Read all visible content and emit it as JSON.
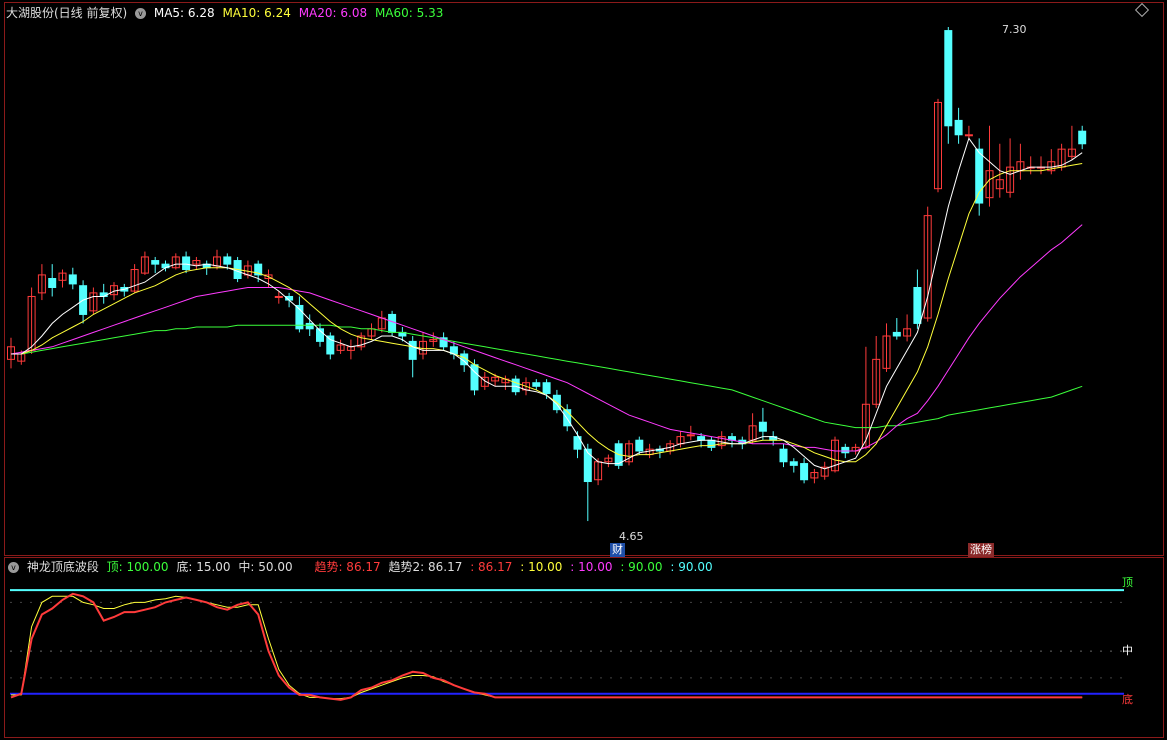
{
  "header": {
    "stock_title": "大湖股份(日线 前复权)",
    "ma5": "MA5: 6.28",
    "ma10": "MA10: 6.24",
    "ma20": "MA20: 6.08",
    "ma60": "MA60: 5.33"
  },
  "indicator": {
    "name": "神龙顶底波段",
    "top": "顶: 100.00",
    "bottom": "底: 15.00",
    "mid": "中: 50.00",
    "trend": "趋势: 86.17",
    "trend2": "趋势2: 86.17",
    "v1": ": 86.17",
    "v2": ": 10.00",
    "v3": ": 10.00",
    "v4": ": 90.00",
    "v5": ": 90.00",
    "label_top": "顶",
    "label_mid": "中",
    "label_bottom": "底"
  },
  "annotations": {
    "high_price": "7.30",
    "low_price": "4.65",
    "cai_badge": "财",
    "zhangting_badge": "涨榜"
  },
  "colors": {
    "up": "#ff3b3b",
    "down": "#54ffff",
    "ma5": "#ffffff",
    "ma10": "#ffff3b",
    "ma20": "#ff3bff",
    "ma60": "#3bff3b",
    "frame": "#8b1a1a"
  },
  "chart_data": {
    "type": "candlestick",
    "y_range": [
      4.5,
      7.45
    ],
    "candles": [
      {
        "o": 5.55,
        "c": 5.62,
        "h": 5.67,
        "l": 5.5
      },
      {
        "o": 5.54,
        "c": 5.58,
        "h": 5.6,
        "l": 5.52
      },
      {
        "o": 5.6,
        "c": 5.9,
        "h": 5.95,
        "l": 5.58
      },
      {
        "o": 5.92,
        "c": 6.02,
        "h": 6.08,
        "l": 5.88
      },
      {
        "o": 6.0,
        "c": 5.95,
        "h": 6.08,
        "l": 5.9
      },
      {
        "o": 5.99,
        "c": 6.03,
        "h": 6.05,
        "l": 5.95
      },
      {
        "o": 6.02,
        "c": 5.97,
        "h": 6.06,
        "l": 5.94
      },
      {
        "o": 5.96,
        "c": 5.8,
        "h": 5.99,
        "l": 5.75
      },
      {
        "o": 5.82,
        "c": 5.92,
        "h": 5.95,
        "l": 5.8
      },
      {
        "o": 5.92,
        "c": 5.9,
        "h": 5.97,
        "l": 5.86
      },
      {
        "o": 5.91,
        "c": 5.96,
        "h": 5.98,
        "l": 5.88
      },
      {
        "o": 5.95,
        "c": 5.93,
        "h": 5.97,
        "l": 5.9
      },
      {
        "o": 5.93,
        "c": 6.05,
        "h": 6.08,
        "l": 5.92
      },
      {
        "o": 6.03,
        "c": 6.12,
        "h": 6.15,
        "l": 6.02
      },
      {
        "o": 6.1,
        "c": 6.08,
        "h": 6.12,
        "l": 6.03
      },
      {
        "o": 6.08,
        "c": 6.06,
        "h": 6.1,
        "l": 6.04
      },
      {
        "o": 6.06,
        "c": 6.12,
        "h": 6.14,
        "l": 6.05
      },
      {
        "o": 6.12,
        "c": 6.05,
        "h": 6.15,
        "l": 6.03
      },
      {
        "o": 6.08,
        "c": 6.1,
        "h": 6.12,
        "l": 6.05
      },
      {
        "o": 6.08,
        "c": 6.06,
        "h": 6.1,
        "l": 6.02
      },
      {
        "o": 6.07,
        "c": 6.12,
        "h": 6.16,
        "l": 6.05
      },
      {
        "o": 6.12,
        "c": 6.08,
        "h": 6.14,
        "l": 6.05
      },
      {
        "o": 6.1,
        "c": 6.0,
        "h": 6.12,
        "l": 5.98
      },
      {
        "o": 6.02,
        "c": 6.07,
        "h": 6.1,
        "l": 6.0
      },
      {
        "o": 6.08,
        "c": 6.02,
        "h": 6.1,
        "l": 5.98
      },
      {
        "o": 6.0,
        "c": 6.02,
        "h": 6.05,
        "l": 5.95
      },
      {
        "o": 5.9,
        "c": 5.9,
        "h": 5.93,
        "l": 5.86
      },
      {
        "o": 5.9,
        "c": 5.88,
        "h": 5.92,
        "l": 5.84
      },
      {
        "o": 5.85,
        "c": 5.72,
        "h": 5.9,
        "l": 5.7
      },
      {
        "o": 5.75,
        "c": 5.72,
        "h": 5.8,
        "l": 5.68
      },
      {
        "o": 5.72,
        "c": 5.65,
        "h": 5.75,
        "l": 5.62
      },
      {
        "o": 5.68,
        "c": 5.58,
        "h": 5.7,
        "l": 5.55
      },
      {
        "o": 5.6,
        "c": 5.63,
        "h": 5.66,
        "l": 5.58
      },
      {
        "o": 5.6,
        "c": 5.62,
        "h": 5.66,
        "l": 5.55
      },
      {
        "o": 5.62,
        "c": 5.68,
        "h": 5.7,
        "l": 5.6
      },
      {
        "o": 5.68,
        "c": 5.72,
        "h": 5.75,
        "l": 5.66
      },
      {
        "o": 5.72,
        "c": 5.78,
        "h": 5.82,
        "l": 5.7
      },
      {
        "o": 5.8,
        "c": 5.7,
        "h": 5.82,
        "l": 5.68
      },
      {
        "o": 5.7,
        "c": 5.68,
        "h": 5.73,
        "l": 5.65
      },
      {
        "o": 5.65,
        "c": 5.55,
        "h": 5.68,
        "l": 5.45
      },
      {
        "o": 5.58,
        "c": 5.65,
        "h": 5.7,
        "l": 5.55
      },
      {
        "o": 5.65,
        "c": 5.66,
        "h": 5.7,
        "l": 5.62
      },
      {
        "o": 5.67,
        "c": 5.62,
        "h": 5.7,
        "l": 5.6
      },
      {
        "o": 5.62,
        "c": 5.58,
        "h": 5.65,
        "l": 5.55
      },
      {
        "o": 5.58,
        "c": 5.52,
        "h": 5.6,
        "l": 5.48
      },
      {
        "o": 5.52,
        "c": 5.38,
        "h": 5.55,
        "l": 5.35
      },
      {
        "o": 5.4,
        "c": 5.45,
        "h": 5.48,
        "l": 5.38
      },
      {
        "o": 5.43,
        "c": 5.45,
        "h": 5.47,
        "l": 5.4
      },
      {
        "o": 5.42,
        "c": 5.44,
        "h": 5.46,
        "l": 5.38
      },
      {
        "o": 5.44,
        "c": 5.37,
        "h": 5.46,
        "l": 5.35
      },
      {
        "o": 5.38,
        "c": 5.42,
        "h": 5.45,
        "l": 5.35
      },
      {
        "o": 5.42,
        "c": 5.4,
        "h": 5.44,
        "l": 5.38
      },
      {
        "o": 5.42,
        "c": 5.36,
        "h": 5.44,
        "l": 5.33
      },
      {
        "o": 5.35,
        "c": 5.27,
        "h": 5.38,
        "l": 5.25
      },
      {
        "o": 5.27,
        "c": 5.18,
        "h": 5.3,
        "l": 5.15
      },
      {
        "o": 5.12,
        "c": 5.05,
        "h": 5.15,
        "l": 5.0
      },
      {
        "o": 5.05,
        "c": 4.87,
        "h": 5.08,
        "l": 4.65
      },
      {
        "o": 4.88,
        "c": 4.98,
        "h": 5.0,
        "l": 4.85
      },
      {
        "o": 4.98,
        "c": 5.0,
        "h": 5.02,
        "l": 4.95
      },
      {
        "o": 5.08,
        "c": 4.96,
        "h": 5.1,
        "l": 4.94
      },
      {
        "o": 4.98,
        "c": 5.08,
        "h": 5.1,
        "l": 4.96
      },
      {
        "o": 5.1,
        "c": 5.04,
        "h": 5.12,
        "l": 5.02
      },
      {
        "o": 5.02,
        "c": 5.05,
        "h": 5.08,
        "l": 5.0
      },
      {
        "o": 5.05,
        "c": 5.04,
        "h": 5.07,
        "l": 5.0
      },
      {
        "o": 5.04,
        "c": 5.08,
        "h": 5.1,
        "l": 5.02
      },
      {
        "o": 5.08,
        "c": 5.12,
        "h": 5.15,
        "l": 5.06
      },
      {
        "o": 5.13,
        "c": 5.13,
        "h": 5.18,
        "l": 5.1
      },
      {
        "o": 5.12,
        "c": 5.1,
        "h": 5.14,
        "l": 5.06
      },
      {
        "o": 5.1,
        "c": 5.06,
        "h": 5.12,
        "l": 5.04
      },
      {
        "o": 5.07,
        "c": 5.12,
        "h": 5.15,
        "l": 5.05
      },
      {
        "o": 5.12,
        "c": 5.1,
        "h": 5.14,
        "l": 5.06
      },
      {
        "o": 5.1,
        "c": 5.08,
        "h": 5.12,
        "l": 5.05
      },
      {
        "o": 5.1,
        "c": 5.18,
        "h": 5.25,
        "l": 5.08
      },
      {
        "o": 5.2,
        "c": 5.15,
        "h": 5.28,
        "l": 5.1
      },
      {
        "o": 5.12,
        "c": 5.1,
        "h": 5.15,
        "l": 5.07
      },
      {
        "o": 5.05,
        "c": 4.98,
        "h": 5.08,
        "l": 4.95
      },
      {
        "o": 4.98,
        "c": 4.96,
        "h": 5.0,
        "l": 4.92
      },
      {
        "o": 4.97,
        "c": 4.88,
        "h": 5.0,
        "l": 4.86
      },
      {
        "o": 4.89,
        "c": 4.92,
        "h": 4.94,
        "l": 4.86
      },
      {
        "o": 4.9,
        "c": 4.95,
        "h": 4.98,
        "l": 4.88
      },
      {
        "o": 4.93,
        "c": 5.1,
        "h": 5.12,
        "l": 4.92
      },
      {
        "o": 5.06,
        "c": 5.03,
        "h": 5.08,
        "l": 5.0
      },
      {
        "o": 5.04,
        "c": 5.06,
        "h": 5.08,
        "l": 5.02
      },
      {
        "o": 5.06,
        "c": 5.3,
        "h": 5.62,
        "l": 5.05
      },
      {
        "o": 5.3,
        "c": 5.55,
        "h": 5.68,
        "l": 5.28
      },
      {
        "o": 5.5,
        "c": 5.68,
        "h": 5.75,
        "l": 5.48
      },
      {
        "o": 5.7,
        "c": 5.68,
        "h": 5.78,
        "l": 5.66
      },
      {
        "o": 5.68,
        "c": 5.72,
        "h": 5.8,
        "l": 5.65
      },
      {
        "o": 5.95,
        "c": 5.75,
        "h": 6.05,
        "l": 5.72
      },
      {
        "o": 5.78,
        "c": 6.35,
        "h": 6.4,
        "l": 5.76
      },
      {
        "o": 6.5,
        "c": 6.98,
        "h": 7.0,
        "l": 6.48
      },
      {
        "o": 7.38,
        "c": 6.85,
        "h": 7.4,
        "l": 6.75
      },
      {
        "o": 6.88,
        "c": 6.8,
        "h": 6.95,
        "l": 6.75
      },
      {
        "o": 6.8,
        "c": 6.8,
        "h": 6.85,
        "l": 6.78
      },
      {
        "o": 6.72,
        "c": 6.42,
        "h": 6.78,
        "l": 6.35
      },
      {
        "o": 6.45,
        "c": 6.6,
        "h": 6.85,
        "l": 6.4
      },
      {
        "o": 6.5,
        "c": 6.55,
        "h": 6.75,
        "l": 6.45
      },
      {
        "o": 6.48,
        "c": 6.62,
        "h": 6.78,
        "l": 6.45
      },
      {
        "o": 6.6,
        "c": 6.65,
        "h": 6.75,
        "l": 6.55
      },
      {
        "o": 6.62,
        "c": 6.62,
        "h": 6.68,
        "l": 6.58
      },
      {
        "o": 6.62,
        "c": 6.62,
        "h": 6.68,
        "l": 6.58
      },
      {
        "o": 6.6,
        "c": 6.65,
        "h": 6.72,
        "l": 6.58
      },
      {
        "o": 6.62,
        "c": 6.72,
        "h": 6.75,
        "l": 6.6
      },
      {
        "o": 6.68,
        "c": 6.72,
        "h": 6.85,
        "l": 6.66
      },
      {
        "o": 6.82,
        "c": 6.75,
        "h": 6.85,
        "l": 6.72
      }
    ],
    "ma5": [
      5.58,
      5.58,
      5.62,
      5.68,
      5.75,
      5.8,
      5.84,
      5.88,
      5.9,
      5.9,
      5.93,
      5.94,
      5.96,
      5.98,
      6.02,
      6.06,
      6.08,
      6.08,
      6.07,
      6.08,
      6.07,
      6.06,
      6.04,
      6.02,
      6.0,
      5.97,
      5.93,
      5.88,
      5.83,
      5.77,
      5.71,
      5.66,
      5.64,
      5.62,
      5.63,
      5.65,
      5.68,
      5.68,
      5.66,
      5.62,
      5.6,
      5.6,
      5.6,
      5.58,
      5.54,
      5.48,
      5.43,
      5.4,
      5.4,
      5.4,
      5.38,
      5.37,
      5.35,
      5.3,
      5.22,
      5.13,
      5.03,
      4.98,
      4.97,
      4.97,
      5.0,
      5.03,
      5.04,
      5.05,
      5.06,
      5.08,
      5.09,
      5.1,
      5.1,
      5.09,
      5.08,
      5.08,
      5.1,
      5.12,
      5.12,
      5.1,
      5.06,
      5.01,
      4.96,
      4.94,
      4.96,
      4.98,
      5.0,
      5.1,
      5.25,
      5.4,
      5.5,
      5.6,
      5.7,
      5.9,
      6.15,
      6.4,
      6.6,
      6.78,
      6.7,
      6.65,
      6.6,
      6.58,
      6.6,
      6.62,
      6.62,
      6.62,
      6.63,
      6.66,
      6.7
    ],
    "ma10": [
      5.58,
      5.58,
      5.6,
      5.63,
      5.67,
      5.7,
      5.73,
      5.76,
      5.8,
      5.83,
      5.86,
      5.89,
      5.92,
      5.94,
      5.96,
      5.99,
      6.02,
      6.04,
      6.05,
      6.06,
      6.06,
      6.06,
      6.05,
      6.04,
      6.03,
      6.01,
      5.98,
      5.95,
      5.91,
      5.86,
      5.81,
      5.76,
      5.72,
      5.69,
      5.67,
      5.66,
      5.65,
      5.64,
      5.63,
      5.62,
      5.61,
      5.61,
      5.6,
      5.58,
      5.56,
      5.52,
      5.49,
      5.46,
      5.44,
      5.42,
      5.4,
      5.38,
      5.35,
      5.31,
      5.26,
      5.2,
      5.14,
      5.09,
      5.05,
      5.02,
      5.01,
      5.02,
      5.02,
      5.03,
      5.04,
      5.05,
      5.06,
      5.07,
      5.07,
      5.08,
      5.08,
      5.08,
      5.09,
      5.1,
      5.1,
      5.1,
      5.08,
      5.06,
      5.03,
      5.01,
      4.99,
      4.98,
      4.98,
      5.02,
      5.08,
      5.18,
      5.28,
      5.38,
      5.48,
      5.62,
      5.8,
      6.0,
      6.18,
      6.36,
      6.48,
      6.55,
      6.58,
      6.6,
      6.6,
      6.6,
      6.6,
      6.61,
      6.62,
      6.63,
      6.64
    ],
    "ma20": [
      5.58,
      5.59,
      5.6,
      5.61,
      5.62,
      5.64,
      5.66,
      5.68,
      5.7,
      5.72,
      5.74,
      5.76,
      5.78,
      5.8,
      5.82,
      5.84,
      5.86,
      5.88,
      5.9,
      5.91,
      5.92,
      5.93,
      5.94,
      5.95,
      5.95,
      5.95,
      5.95,
      5.94,
      5.93,
      5.92,
      5.9,
      5.88,
      5.86,
      5.84,
      5.82,
      5.8,
      5.78,
      5.76,
      5.74,
      5.72,
      5.7,
      5.68,
      5.66,
      5.64,
      5.62,
      5.6,
      5.58,
      5.56,
      5.54,
      5.52,
      5.5,
      5.48,
      5.46,
      5.44,
      5.42,
      5.39,
      5.36,
      5.33,
      5.3,
      5.27,
      5.24,
      5.22,
      5.2,
      5.18,
      5.16,
      5.15,
      5.14,
      5.13,
      5.12,
      5.11,
      5.1,
      5.09,
      5.08,
      5.08,
      5.08,
      5.08,
      5.07,
      5.06,
      5.06,
      5.05,
      5.04,
      5.04,
      5.04,
      5.06,
      5.09,
      5.13,
      5.18,
      5.22,
      5.25,
      5.32,
      5.4,
      5.49,
      5.58,
      5.67,
      5.75,
      5.82,
      5.89,
      5.95,
      6.01,
      6.06,
      6.11,
      6.16,
      6.2,
      6.25,
      6.3
    ],
    "ma60": [
      5.58,
      5.58,
      5.59,
      5.6,
      5.61,
      5.62,
      5.63,
      5.64,
      5.65,
      5.66,
      5.67,
      5.68,
      5.69,
      5.7,
      5.71,
      5.71,
      5.72,
      5.72,
      5.73,
      5.73,
      5.73,
      5.73,
      5.74,
      5.74,
      5.74,
      5.74,
      5.74,
      5.74,
      5.74,
      5.74,
      5.74,
      5.74,
      5.73,
      5.73,
      5.72,
      5.72,
      5.71,
      5.7,
      5.7,
      5.69,
      5.68,
      5.67,
      5.66,
      5.65,
      5.64,
      5.63,
      5.62,
      5.61,
      5.6,
      5.59,
      5.58,
      5.57,
      5.56,
      5.55,
      5.54,
      5.53,
      5.52,
      5.51,
      5.5,
      5.49,
      5.48,
      5.47,
      5.46,
      5.45,
      5.44,
      5.43,
      5.42,
      5.41,
      5.4,
      5.39,
      5.38,
      5.36,
      5.34,
      5.32,
      5.3,
      5.28,
      5.26,
      5.24,
      5.22,
      5.2,
      5.19,
      5.18,
      5.17,
      5.17,
      5.17,
      5.18,
      5.18,
      5.19,
      5.2,
      5.21,
      5.22,
      5.24,
      5.25,
      5.26,
      5.27,
      5.28,
      5.29,
      5.3,
      5.31,
      5.32,
      5.33,
      5.34,
      5.36,
      5.38,
      5.4
    ],
    "indicator_range": [
      0,
      110
    ],
    "trend": [
      12,
      15,
      60,
      80,
      85,
      92,
      97,
      95,
      90,
      75,
      78,
      82,
      82,
      84,
      86,
      90,
      92,
      94,
      92,
      90,
      86,
      84,
      88,
      90,
      80,
      50,
      30,
      20,
      14,
      14,
      12,
      11,
      10,
      12,
      18,
      20,
      24,
      26,
      30,
      33,
      32,
      28,
      26,
      22,
      19,
      16,
      15,
      12,
      12,
      12,
      12,
      12,
      12,
      12,
      12,
      12,
      12,
      12,
      12,
      12,
      12,
      12,
      12,
      12,
      12,
      12,
      12,
      12,
      12,
      12,
      12,
      12,
      12,
      12,
      12,
      12,
      12,
      12,
      12,
      12,
      12,
      12,
      12,
      12,
      12,
      12,
      12,
      12,
      12,
      12,
      12,
      12,
      12,
      12,
      12,
      12,
      12,
      12,
      12,
      12,
      12,
      12,
      12,
      12,
      12
    ],
    "trend2": [
      14,
      14,
      70,
      90,
      95,
      95,
      95,
      90,
      88,
      85,
      85,
      88,
      90,
      90,
      92,
      93,
      95,
      94,
      92,
      90,
      88,
      86,
      86,
      88,
      88,
      60,
      35,
      22,
      15,
      12,
      12,
      11,
      11,
      12,
      16,
      19,
      22,
      25,
      28,
      30,
      30,
      29,
      25,
      22,
      19,
      16,
      14,
      12,
      12,
      12,
      12,
      12,
      12,
      12,
      12,
      12,
      12,
      12,
      12,
      12,
      12,
      12,
      12,
      12,
      12,
      12,
      12,
      12,
      12,
      12,
      12,
      12,
      12,
      12,
      12,
      12,
      12,
      12,
      12,
      12,
      12,
      12,
      12,
      12,
      12,
      12,
      12,
      12,
      12,
      12,
      12,
      12,
      12,
      12,
      12,
      12,
      12,
      12,
      12,
      12,
      12,
      12,
      12,
      12,
      12
    ]
  }
}
